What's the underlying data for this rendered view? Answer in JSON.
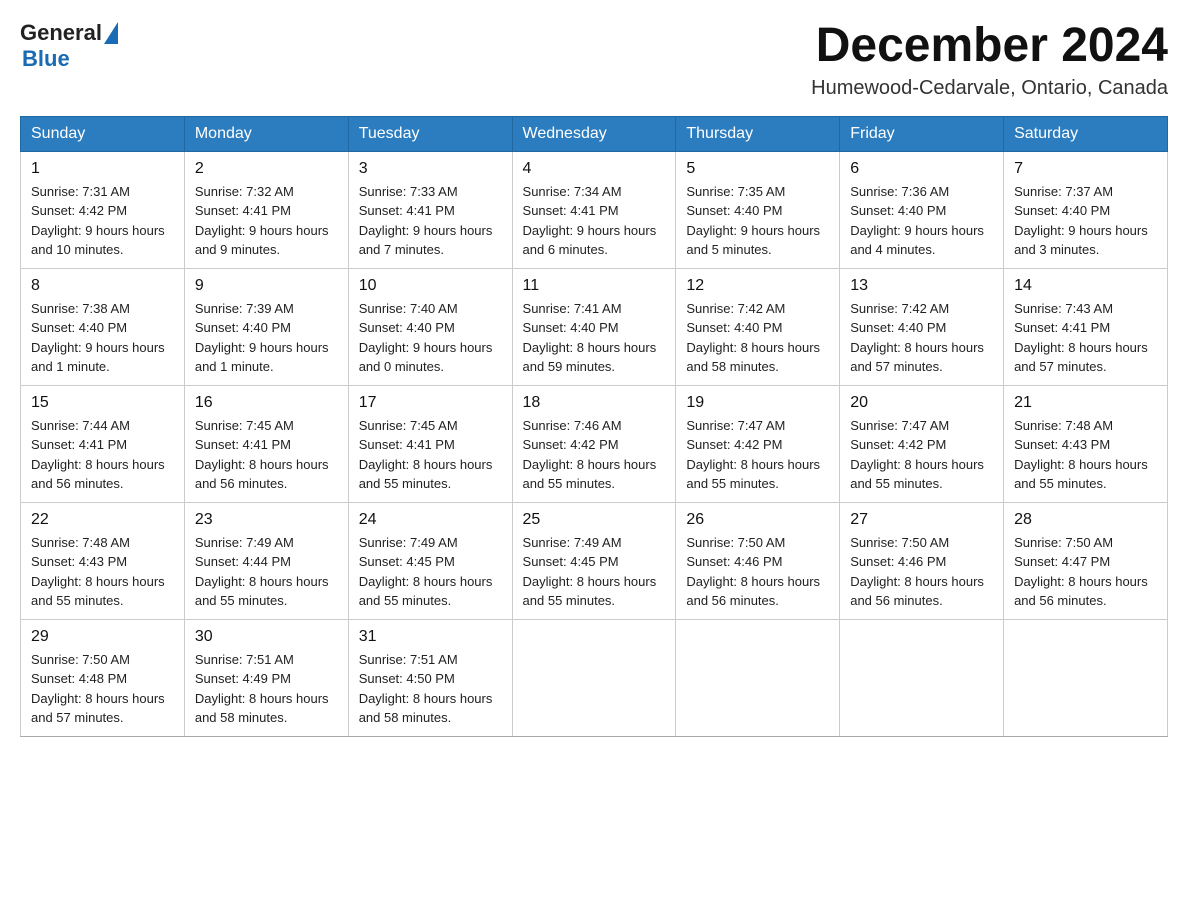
{
  "header": {
    "logo_general": "General",
    "logo_blue": "Blue",
    "month_title": "December 2024",
    "location": "Humewood-Cedarvale, Ontario, Canada"
  },
  "days_of_week": [
    "Sunday",
    "Monday",
    "Tuesday",
    "Wednesday",
    "Thursday",
    "Friday",
    "Saturday"
  ],
  "weeks": [
    [
      {
        "day": "1",
        "sunrise": "7:31 AM",
        "sunset": "4:42 PM",
        "daylight": "9 hours and 10 minutes."
      },
      {
        "day": "2",
        "sunrise": "7:32 AM",
        "sunset": "4:41 PM",
        "daylight": "9 hours and 9 minutes."
      },
      {
        "day": "3",
        "sunrise": "7:33 AM",
        "sunset": "4:41 PM",
        "daylight": "9 hours and 7 minutes."
      },
      {
        "day": "4",
        "sunrise": "7:34 AM",
        "sunset": "4:41 PM",
        "daylight": "9 hours and 6 minutes."
      },
      {
        "day": "5",
        "sunrise": "7:35 AM",
        "sunset": "4:40 PM",
        "daylight": "9 hours and 5 minutes."
      },
      {
        "day": "6",
        "sunrise": "7:36 AM",
        "sunset": "4:40 PM",
        "daylight": "9 hours and 4 minutes."
      },
      {
        "day": "7",
        "sunrise": "7:37 AM",
        "sunset": "4:40 PM",
        "daylight": "9 hours and 3 minutes."
      }
    ],
    [
      {
        "day": "8",
        "sunrise": "7:38 AM",
        "sunset": "4:40 PM",
        "daylight": "9 hours and 1 minute."
      },
      {
        "day": "9",
        "sunrise": "7:39 AM",
        "sunset": "4:40 PM",
        "daylight": "9 hours and 1 minute."
      },
      {
        "day": "10",
        "sunrise": "7:40 AM",
        "sunset": "4:40 PM",
        "daylight": "9 hours and 0 minutes."
      },
      {
        "day": "11",
        "sunrise": "7:41 AM",
        "sunset": "4:40 PM",
        "daylight": "8 hours and 59 minutes."
      },
      {
        "day": "12",
        "sunrise": "7:42 AM",
        "sunset": "4:40 PM",
        "daylight": "8 hours and 58 minutes."
      },
      {
        "day": "13",
        "sunrise": "7:42 AM",
        "sunset": "4:40 PM",
        "daylight": "8 hours and 57 minutes."
      },
      {
        "day": "14",
        "sunrise": "7:43 AM",
        "sunset": "4:41 PM",
        "daylight": "8 hours and 57 minutes."
      }
    ],
    [
      {
        "day": "15",
        "sunrise": "7:44 AM",
        "sunset": "4:41 PM",
        "daylight": "8 hours and 56 minutes."
      },
      {
        "day": "16",
        "sunrise": "7:45 AM",
        "sunset": "4:41 PM",
        "daylight": "8 hours and 56 minutes."
      },
      {
        "day": "17",
        "sunrise": "7:45 AM",
        "sunset": "4:41 PM",
        "daylight": "8 hours and 55 minutes."
      },
      {
        "day": "18",
        "sunrise": "7:46 AM",
        "sunset": "4:42 PM",
        "daylight": "8 hours and 55 minutes."
      },
      {
        "day": "19",
        "sunrise": "7:47 AM",
        "sunset": "4:42 PM",
        "daylight": "8 hours and 55 minutes."
      },
      {
        "day": "20",
        "sunrise": "7:47 AM",
        "sunset": "4:42 PM",
        "daylight": "8 hours and 55 minutes."
      },
      {
        "day": "21",
        "sunrise": "7:48 AM",
        "sunset": "4:43 PM",
        "daylight": "8 hours and 55 minutes."
      }
    ],
    [
      {
        "day": "22",
        "sunrise": "7:48 AM",
        "sunset": "4:43 PM",
        "daylight": "8 hours and 55 minutes."
      },
      {
        "day": "23",
        "sunrise": "7:49 AM",
        "sunset": "4:44 PM",
        "daylight": "8 hours and 55 minutes."
      },
      {
        "day": "24",
        "sunrise": "7:49 AM",
        "sunset": "4:45 PM",
        "daylight": "8 hours and 55 minutes."
      },
      {
        "day": "25",
        "sunrise": "7:49 AM",
        "sunset": "4:45 PM",
        "daylight": "8 hours and 55 minutes."
      },
      {
        "day": "26",
        "sunrise": "7:50 AM",
        "sunset": "4:46 PM",
        "daylight": "8 hours and 56 minutes."
      },
      {
        "day": "27",
        "sunrise": "7:50 AM",
        "sunset": "4:46 PM",
        "daylight": "8 hours and 56 minutes."
      },
      {
        "day": "28",
        "sunrise": "7:50 AM",
        "sunset": "4:47 PM",
        "daylight": "8 hours and 56 minutes."
      }
    ],
    [
      {
        "day": "29",
        "sunrise": "7:50 AM",
        "sunset": "4:48 PM",
        "daylight": "8 hours and 57 minutes."
      },
      {
        "day": "30",
        "sunrise": "7:51 AM",
        "sunset": "4:49 PM",
        "daylight": "8 hours and 58 minutes."
      },
      {
        "day": "31",
        "sunrise": "7:51 AM",
        "sunset": "4:50 PM",
        "daylight": "8 hours and 58 minutes."
      },
      null,
      null,
      null,
      null
    ]
  ],
  "labels": {
    "sunrise": "Sunrise:",
    "sunset": "Sunset:",
    "daylight": "Daylight:"
  }
}
